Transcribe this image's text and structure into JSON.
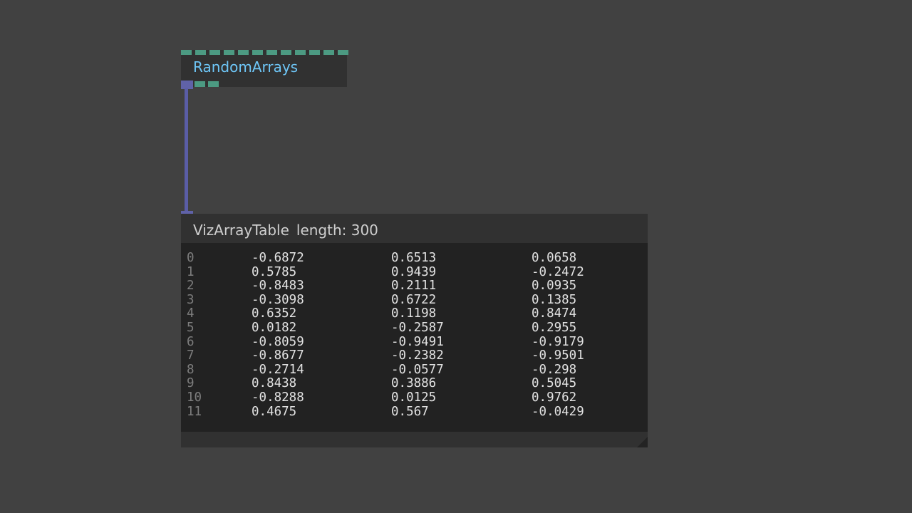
{
  "nodes": {
    "random_arrays": {
      "title": "RandomArrays",
      "input_port_count": 12,
      "output_port_count": 2
    },
    "viz_array_table": {
      "title": "VizArrayTable",
      "length_label": "length: 300",
      "rows": [
        {
          "index": "0",
          "values": [
            "-0.6872",
            "0.6513",
            "0.0658"
          ]
        },
        {
          "index": "1",
          "values": [
            "0.5785",
            "0.9439",
            "-0.2472"
          ]
        },
        {
          "index": "2",
          "values": [
            "-0.8483",
            "0.2111",
            "0.0935"
          ]
        },
        {
          "index": "3",
          "values": [
            "-0.3098",
            "0.6722",
            "0.1385"
          ]
        },
        {
          "index": "4",
          "values": [
            "0.6352",
            "0.1198",
            "0.8474"
          ]
        },
        {
          "index": "5",
          "values": [
            "0.0182",
            "-0.2587",
            "0.2955"
          ]
        },
        {
          "index": "6",
          "values": [
            "-0.8059",
            "-0.9491",
            "-0.9179"
          ]
        },
        {
          "index": "7",
          "values": [
            "-0.8677",
            "-0.2382",
            "-0.9501"
          ]
        },
        {
          "index": "8",
          "values": [
            "-0.2714",
            "-0.0577",
            "-0.298"
          ]
        },
        {
          "index": "9",
          "values": [
            "0.8438",
            "0.3886",
            "0.5045"
          ]
        },
        {
          "index": "10",
          "values": [
            "-0.8288",
            "0.0125",
            "0.9762"
          ]
        },
        {
          "index": "11",
          "values": [
            "0.4675",
            "0.567",
            "-0.0429"
          ]
        }
      ]
    }
  },
  "colors": {
    "canvas_bg": "#414141",
    "node_bg": "#313131",
    "table_bg": "#222222",
    "port_green": "#4c9a82",
    "port_blue": "#6062a8",
    "wire_blue": "#5a5da6",
    "title_accent": "#6ec6f7"
  }
}
